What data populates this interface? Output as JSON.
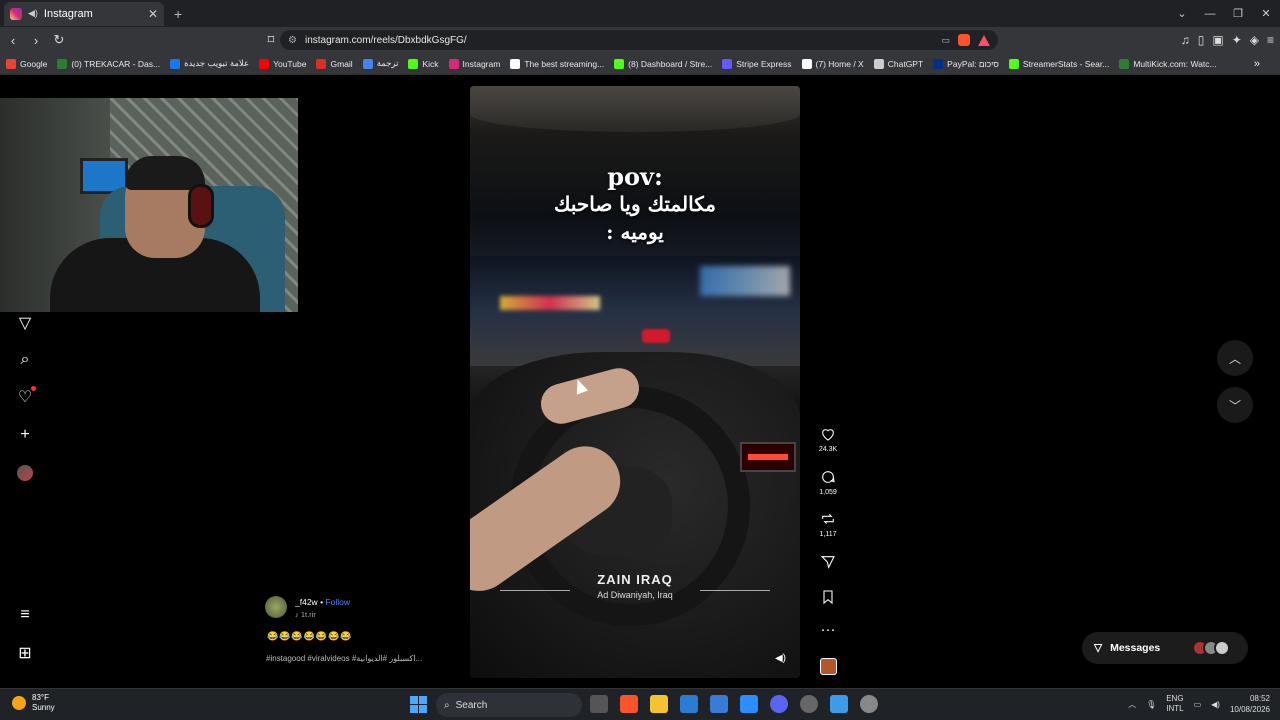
{
  "browser": {
    "tab_title": "Instagram",
    "url": "instagram.com/reels/DbxbdkGsgFG/",
    "bookmarks": [
      {
        "label": "Google",
        "color": "#ea4335"
      },
      {
        "label": "(0) TREKACAR - Das...",
        "color": "#2d7d32"
      },
      {
        "label": "علامة تبويب جديدة",
        "color": "#1877f2"
      },
      {
        "label": "YouTube",
        "color": "#ff0000"
      },
      {
        "label": "Gmail",
        "color": "#d93025"
      },
      {
        "label": "ترجمة",
        "color": "#4285f4"
      },
      {
        "label": "Kick",
        "color": "#53fc18"
      },
      {
        "label": "Instagram",
        "color": "#d62976"
      },
      {
        "label": "The best streaming...",
        "color": "#ffffff"
      },
      {
        "label": "(8) Dashboard / Stre...",
        "color": "#53fc18"
      },
      {
        "label": "Stripe Express",
        "color": "#635bff"
      },
      {
        "label": "(7) Home / X",
        "color": "#ffffff"
      },
      {
        "label": "ChatGPT",
        "color": "#cccccc"
      },
      {
        "label": "PayPal: סיכום",
        "color": "#003087"
      },
      {
        "label": "StreamerStats - Sear...",
        "color": "#53fc18"
      },
      {
        "label": "MultiKick.com: Watc...",
        "color": "#2d7d32"
      }
    ]
  },
  "reel": {
    "overlay_line1": "pov:",
    "overlay_line2": "مكالمتك ويا صاحبك",
    "overlay_line3": "يوميه :",
    "sponsor_brand": "ZAIN IRAQ",
    "sponsor_location": "Ad Diwaniyah, Iraq"
  },
  "actions": {
    "likes": "24.3K",
    "comments": "1,059",
    "reposts": "1,117"
  },
  "caption": {
    "username": "_f42w",
    "separator": "•",
    "follow": "Follow",
    "audio": "1t.rir",
    "emojis": "😂😂😂😂😂😂😂",
    "tags": "#instagood #viralvideos #اكسبلور #الديوانية..."
  },
  "messages": {
    "label": "Messages"
  },
  "taskbar": {
    "temperature": "83°F",
    "condition": "Sunny",
    "search_label": "Search",
    "lang1": "ENG",
    "lang2": "INTL",
    "time": "08:52",
    "date": "10/08/2026"
  }
}
